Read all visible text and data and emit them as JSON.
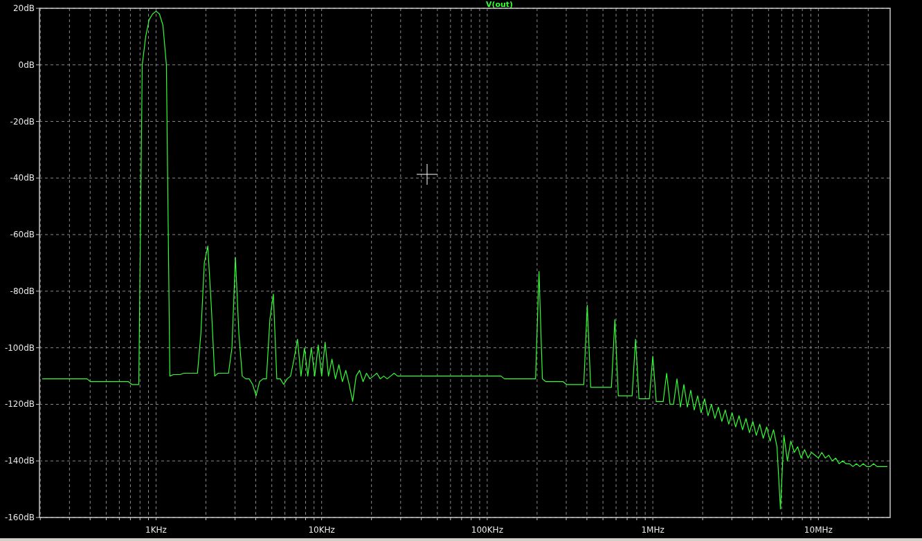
{
  "plot": {
    "chart_data": {
      "type": "line",
      "grid": true,
      "ylim": [
        -160,
        20
      ],
      "yticks": [
        {
          "value": 20,
          "label": "20dB"
        },
        {
          "value": 0,
          "label": "0dB"
        },
        {
          "value": -20,
          "label": "-20dB"
        },
        {
          "value": -40,
          "label": "-40dB"
        },
        {
          "value": -60,
          "label": "-60dB"
        },
        {
          "value": -80,
          "label": "-80dB"
        },
        {
          "value": -100,
          "label": "-100dB"
        },
        {
          "value": -120,
          "label": "-120dB"
        },
        {
          "value": -140,
          "label": "-140dB"
        },
        {
          "value": -160,
          "label": "-160dB"
        }
      ],
      "categories": [
        null,
        null,
        null,
        null,
        null,
        null,
        null,
        null,
        null,
        null,
        null,
        null,
        null,
        null,
        null,
        null,
        null,
        null,
        null,
        null,
        null,
        null,
        null,
        null,
        null,
        null,
        null,
        null,
        null,
        null,
        null,
        null,
        null,
        "1KHz",
        null,
        null,
        null,
        null,
        null,
        null,
        null,
        null,
        null,
        null,
        null,
        null,
        null,
        null,
        null,
        null,
        null,
        null,
        null,
        null,
        null,
        null,
        null,
        null,
        null,
        null,
        null,
        null,
        null,
        null,
        null,
        null,
        null,
        null,
        null,
        null,
        null,
        null,
        null,
        null,
        null,
        null,
        null,
        null,
        null,
        null,
        null,
        "10KHz",
        null,
        null,
        null,
        null,
        null,
        null,
        null,
        null,
        null,
        null,
        null,
        null,
        null,
        null,
        null,
        null,
        null,
        null,
        null,
        null,
        null,
        null,
        null,
        null,
        null,
        null,
        null,
        null,
        null,
        null,
        null,
        null,
        null,
        null,
        null,
        null,
        null,
        null,
        null,
        null,
        null,
        null,
        null,
        null,
        null,
        null,
        null,
        "100KHz",
        null,
        null,
        null,
        null,
        null,
        null,
        null,
        null,
        null,
        null,
        null,
        null,
        null,
        null,
        null,
        null,
        null,
        null,
        null,
        null,
        null,
        null,
        null,
        null,
        null,
        null,
        null,
        null,
        null,
        null,
        null,
        null,
        null,
        null,
        null,
        null,
        null,
        null,
        null,
        null,
        null,
        null,
        null,
        null,
        null,
        null,
        null,
        "1MHz",
        null,
        null,
        null,
        null,
        null,
        null,
        null,
        null,
        null,
        null,
        null,
        null,
        null,
        null,
        null,
        null,
        null,
        null,
        null,
        null,
        null,
        null,
        null,
        null,
        null,
        null,
        null,
        null,
        null,
        null,
        null,
        null,
        null,
        null,
        null,
        null,
        null,
        null,
        null,
        null,
        null,
        null,
        null,
        null,
        null,
        null,
        null,
        "10MHz",
        null,
        null,
        null,
        null,
        null,
        null,
        null,
        null,
        null,
        null,
        null,
        null,
        null,
        null,
        null,
        null,
        null,
        null,
        null,
        null
      ],
      "series": [
        {
          "name": "V(out)",
          "color": "#33ff33",
          "values": [
            -111,
            -111,
            -111,
            -111,
            -111,
            -111,
            -111,
            -111,
            -111,
            -111,
            -111,
            -111,
            -111,
            -111,
            -112,
            -112,
            -112,
            -112,
            -112,
            -112,
            -112,
            -112,
            -112,
            -112,
            -112,
            -112,
            -113,
            -113,
            -113,
            0,
            10,
            16,
            18,
            19,
            18,
            14,
            0,
            -110,
            -109.5,
            -109.5,
            -109.5,
            -109,
            -109,
            -109,
            -109,
            -109,
            -95,
            -70,
            -64,
            -85,
            -110,
            -109,
            -109,
            -109,
            -109,
            -100,
            -68,
            -95,
            -110,
            -111,
            -111,
            -113,
            -117,
            -112,
            -111,
            -111,
            -90,
            -81,
            -111,
            -111,
            -113,
            -111,
            -110,
            -104,
            -97,
            -110,
            -100,
            -110,
            -100,
            -110,
            -99,
            -110,
            -98,
            -110,
            -104,
            -111,
            -106,
            -112,
            -108,
            -113,
            -119,
            -110,
            -108,
            -112,
            -109,
            -111,
            -110,
            -109,
            -111,
            -110,
            -111,
            -110,
            -109,
            -110,
            -110,
            -110,
            -110,
            -110,
            -110,
            -110,
            -110,
            -110,
            -110,
            -110,
            -110,
            -110,
            -110,
            -110,
            -110,
            -110,
            -110,
            -110,
            -110,
            -110,
            -110,
            -110,
            -110,
            -110,
            -110,
            -110,
            -110,
            -110,
            -110,
            -110,
            -111,
            -111,
            -111,
            -111,
            -111,
            -111,
            -111,
            -111,
            -111,
            -111,
            -73,
            -111,
            -112,
            -112,
            -112,
            -112,
            -112,
            -112,
            -113,
            -113,
            -113,
            -113,
            -113,
            -113,
            -85,
            -114,
            -114,
            -114,
            -114,
            -114,
            -114,
            -114,
            -90,
            -117,
            -117,
            -117,
            -117,
            -117,
            -97,
            -118,
            -118,
            -118,
            -118,
            -103,
            -119,
            -119,
            -119,
            -109,
            -120,
            -120,
            -111,
            -121,
            -113,
            -121,
            -115,
            -122,
            -117,
            -123,
            -118,
            -124,
            -120,
            -125,
            -121,
            -126,
            -122,
            -127,
            -123,
            -128,
            -124,
            -129,
            -125,
            -130,
            -126,
            -131,
            -127,
            -132,
            -128,
            -133,
            -129,
            -135,
            -157,
            -131,
            -140,
            -133,
            -137,
            -135,
            -139,
            -136,
            -139,
            -137,
            -138,
            -139,
            -137,
            -139,
            -138,
            -140,
            -139,
            -141,
            -140,
            -141,
            -141,
            -142,
            -141,
            -142,
            -141,
            -142,
            -142,
            -141,
            -142,
            -142,
            -142,
            -142
          ]
        }
      ]
    }
  }
}
